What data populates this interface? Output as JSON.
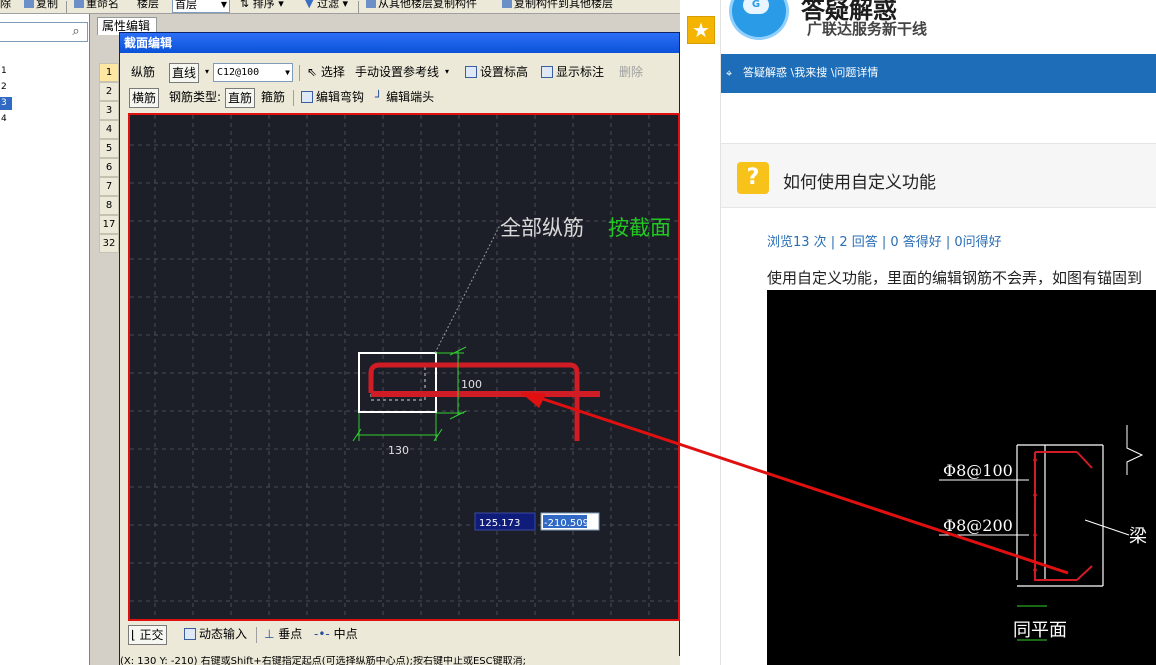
{
  "toolbar_top": {
    "items": [
      "除",
      "复制",
      "重命名",
      "楼层",
      "首层",
      "排序",
      "过滤",
      "从其他楼层复制构件",
      "复制构件到其他楼层"
    ]
  },
  "left_panel": {
    "tree_items": [
      "1",
      "2",
      "3",
      "4"
    ],
    "selected_index": 2
  },
  "property_tab": "属性编辑",
  "row_numbers": [
    "1",
    "2",
    "3",
    "4",
    "5",
    "6",
    "7",
    "8",
    "17",
    "32"
  ],
  "dialog": {
    "title": "截面编辑",
    "toolbar1": {
      "rebar_label": "纵筋",
      "line_label": "直线",
      "spec_value": "C12@100",
      "select_label": "选择",
      "refline_label": "手动设置参考线",
      "set_elev_label": "设置标高",
      "show_label_label": "显示标注",
      "delete_label": "删除"
    },
    "toolbar2": {
      "horiz_label": "横筋",
      "rebar_type_label": "钢筋类型:",
      "straight_label": "直筋",
      "stirrup_label": "箍筋",
      "edit_hook_label": "编辑弯钩",
      "edit_end_label": "编辑端头"
    },
    "canvas": {
      "label_all": "全部纵筋",
      "label_section": "按截面",
      "dim_height": "100",
      "dim_width": "130",
      "coord_x": "125.173",
      "coord_y": "-210.509"
    },
    "bottom": {
      "ortho_label": "正交",
      "dynamic_label": "动态输入",
      "perp_label": "垂点",
      "mid_label": "中点"
    },
    "status": "(X: 130 Y: -210)      右键或Shift+右键指定起点(可选择纵筋中心点);按右键中止或ESC键取消;"
  },
  "web": {
    "site_title": "答疑解惑",
    "slogan": "广联达服务新干线",
    "breadcrumb": "答疑解惑 \\我来搜 \\问题详情",
    "question_title": "如何使用自定义功能",
    "stats": "浏览13 次 | 2 回答 | 0 答得好 | 0问得好",
    "body": "使用自定义功能，里面的编辑钢筋不会弄，如图有锚固到",
    "image_labels": {
      "rebar1": "Φ8@100",
      "rebar2": "Φ8@200",
      "beam": "梁",
      "flush": "同平面"
    }
  },
  "colors": {
    "canvas_bg": "#1c1e28",
    "rebar_red": "#d01c24",
    "arrow_red": "#e01010",
    "green_text": "#22c722",
    "nav_blue": "#1d6db8",
    "question_yellow": "#f7c21a"
  }
}
